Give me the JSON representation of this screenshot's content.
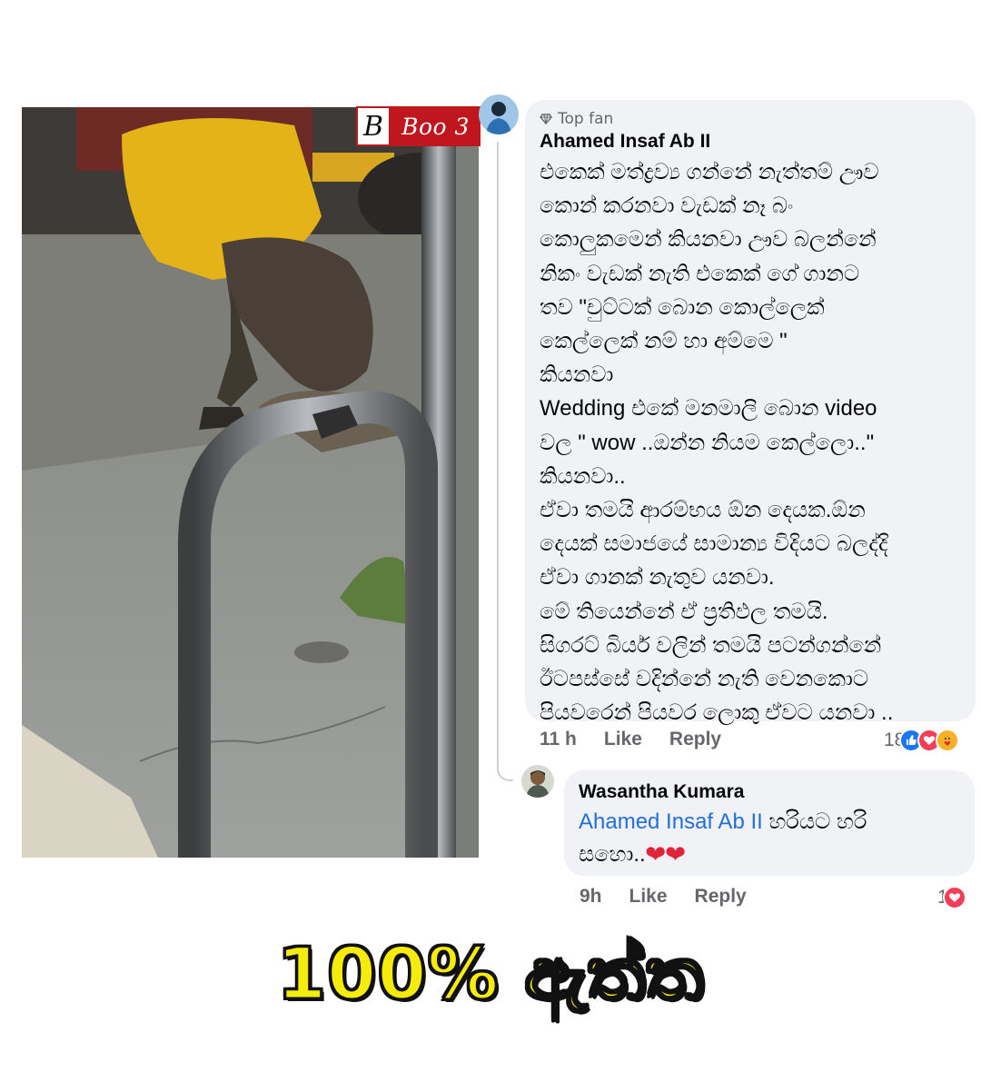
{
  "watermark": {
    "letter": "B",
    "text": "Boo 3"
  },
  "main_comment": {
    "badge": "Top fan",
    "author": "Ahamed Insaf Ab II",
    "lines": [
      "එකෙක් මත්ද්‍රව්‍ය ගන්නේ නැත්තම් ඌව",
      "කොන් කරනවා වැඩක් නෑ බං",
      "කොලුකමෙන් කියනවා ඌව බලන්නේ",
      "නිකං වැඩක් නැති එකෙක් ගේ ගානට",
      "තව \"චුට්ටක් බොන කොල්ලෙක්",
      "කෙල්ලෙක් නම් හා අම්මෙ \"",
      "කියනවා",
      "Wedding එකේ මනමාලි බොන video",
      "වල  \" wow ..ඔන්න නියම කෙල්ලො..\"",
      "කියනවා..",
      "ඒවා තමයි ආරම්භය ඕන දෙයක.ඕන",
      "දෙයක් සමාජයේ සාමාන්‍ය විදියට බලද්දි",
      "ඒවා ගානක් නැතුව යනවා.",
      "මේ තියෙන්නේ ඒ ප්‍රතිඵල තමයි.",
      "සිගරට් බියර් වලින් තමයි පටන්ගන්නේ",
      "ඊටපස්සේ වදින්නේ නැති වෙනකොට",
      "පියවරෙන් පියවර ලොකු ඒවට යනවා .."
    ],
    "time": "11 h",
    "like": "Like",
    "reply": "Reply",
    "reaction_count": "18"
  },
  "reply_comment": {
    "author": "Wasantha Kumara",
    "mention": "Ahamed Insaf Ab II",
    "text_after_mention": " හරියට හරි",
    "line2": "සහො..",
    "hearts": "❤❤",
    "time": "9h",
    "like": "Like",
    "reply": "Reply",
    "reaction_count": "1"
  },
  "caption": "100% ඇත්ත",
  "colors": {
    "bubble": "#f0f2f5",
    "mention": "#216fdb",
    "secondary_text": "#65676b",
    "caption_fill": "#f5eb0c",
    "watermark_red": "#c0161e"
  },
  "icons": [
    "diamond-icon",
    "like-reaction-icon",
    "love-reaction-icon",
    "care-reaction-icon"
  ]
}
